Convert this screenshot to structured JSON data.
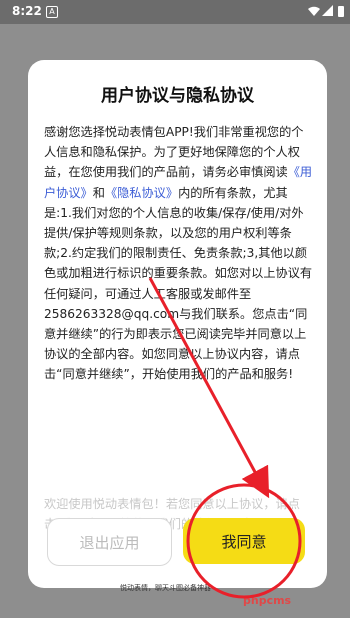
{
  "status_bar": {
    "time": "8:22",
    "notification_letter": "A"
  },
  "dialog": {
    "title": "用户协议与隐私协议",
    "body": {
      "part1": "感谢您选择悦动表情包APP!我们非常重视您的个人信息和隐私保护。为了更好地保障您的个人权益，在您使用我们的产品前，请务必审慎阅读",
      "link_user_agreement": "《用户协议》",
      "and": "和",
      "link_privacy_agreement": "《隐私协议》",
      "part2": "内的所有条款，尤其是:1.我们对您的个人信息的收集/保存/使用/对外提供/保护等规则条款，以及您的用户权利等条款;2.约定我们的限制责任、免责条款;3,其他以颜色或加粗进行标识的重要条款。如您对以上协议有任何疑问，可通过人工客服或发邮件至2586263328@qq.com与我们联系。您点击“同意并继续”的行为即表示您已阅读完毕并同意以上协议的全部内容。如您同意以上协议内容，请点击“同意并继续”，开始使用我们的产品和服务!"
    },
    "welcome_text": "欢迎使用悦动表情包！若您同意以上协议，请点击\"我同意\",开始使用我们的软件与服务。",
    "exit_button": "退出应用",
    "agree_button": "我同意"
  },
  "bottom_caption": "悦动表情，聊天斗图必备神器",
  "watermark": "phpcms",
  "colors": {
    "accent": "#f5dc15",
    "link": "#3d5ed6",
    "annotation": "#e8202a"
  }
}
